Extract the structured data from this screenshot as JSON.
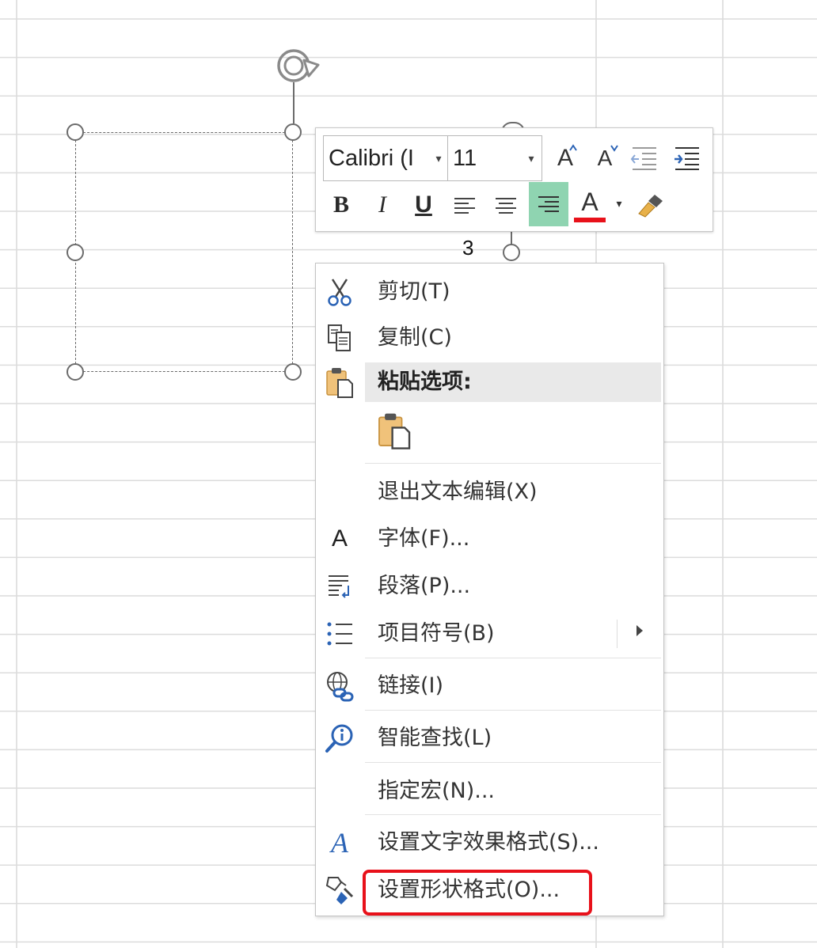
{
  "toolbar": {
    "font_name": "Calibri (I",
    "font_size": "11",
    "bold_label": "B",
    "italic_label": "I",
    "underline_label": "U",
    "grow_font_label": "A",
    "shrink_font_label": "A",
    "font_color_label": "A",
    "font_color": "#e8111a"
  },
  "shape_label": "3",
  "context_menu": {
    "items": [
      {
        "label": "剪切(T)",
        "icon": "scissors-icon"
      },
      {
        "label": "复制(C)",
        "icon": "copy-icon"
      },
      {
        "label": "粘贴选项:",
        "icon": "paste-icon"
      },
      {
        "label": "退出文本编辑(X)",
        "icon": ""
      },
      {
        "label": "字体(F)...",
        "icon": "font-icon",
        "glyph": "A"
      },
      {
        "label": "段落(P)...",
        "icon": "paragraph-icon"
      },
      {
        "label": "项目符号(B)",
        "icon": "bullets-icon"
      },
      {
        "label": "链接(I)",
        "icon": "link-icon"
      },
      {
        "label": "智能查找(L)",
        "icon": "smart-lookup-icon"
      },
      {
        "label": "指定宏(N)...",
        "icon": ""
      },
      {
        "label": "设置文字效果格式(S)...",
        "icon": "text-effects-icon",
        "glyph": "A"
      },
      {
        "label": "设置形状格式(O)...",
        "icon": "format-shape-icon"
      }
    ]
  },
  "colors": {
    "highlight_border": "#e8111a",
    "active_align": "#8fd4b1",
    "accent_blue": "#2b63b5"
  }
}
